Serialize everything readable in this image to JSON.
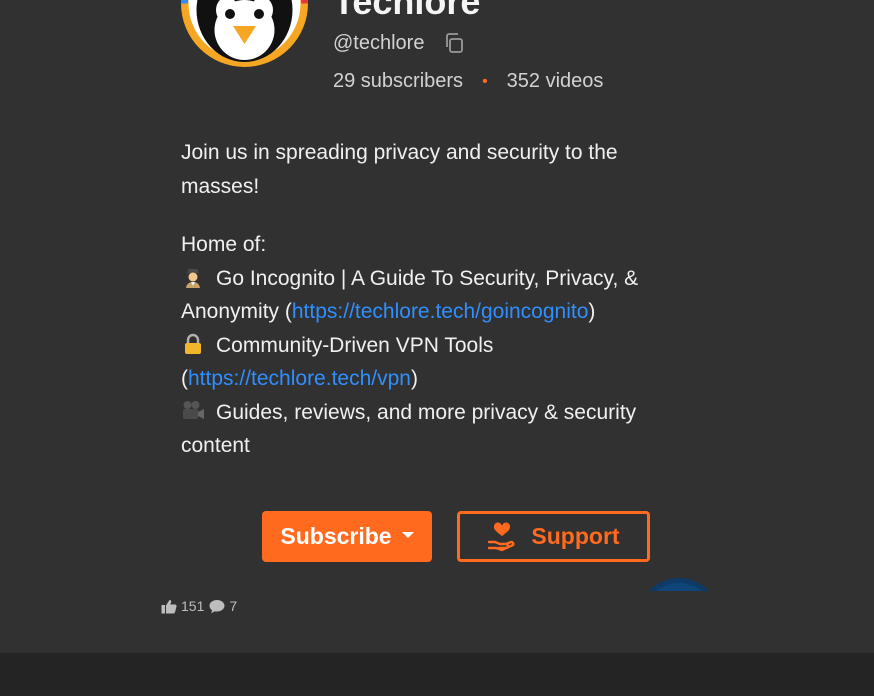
{
  "channel": {
    "name": "Techlore",
    "handle": "@techlore",
    "subscribers": "29 subscribers",
    "separator": "•",
    "videos": "352 videos"
  },
  "description": {
    "tagline": "Join us in spreading privacy and security to the masses!",
    "home_heading": "Home of:",
    "items": [
      {
        "icon": "detective-icon",
        "text": "Go Incognito | A Guide To Security, Privacy, & Anonymity (",
        "link": "https://techlore.tech/goincognito",
        "after": ")"
      },
      {
        "icon": "lock-icon",
        "text": "Community-Driven VPN Tools",
        "text2": "(",
        "link": "https://techlore.tech/vpn",
        "after": ")"
      },
      {
        "icon": "movie-camera-icon",
        "text": "Guides, reviews, and more privacy & security content"
      }
    ]
  },
  "actions": {
    "subscribe_label": "Subscribe",
    "support_label": "Support"
  },
  "meta": {
    "likes": "151",
    "comments": "7"
  },
  "colors": {
    "background": "#313131",
    "accent": "#ff6a1f",
    "link": "#2f8fff"
  }
}
